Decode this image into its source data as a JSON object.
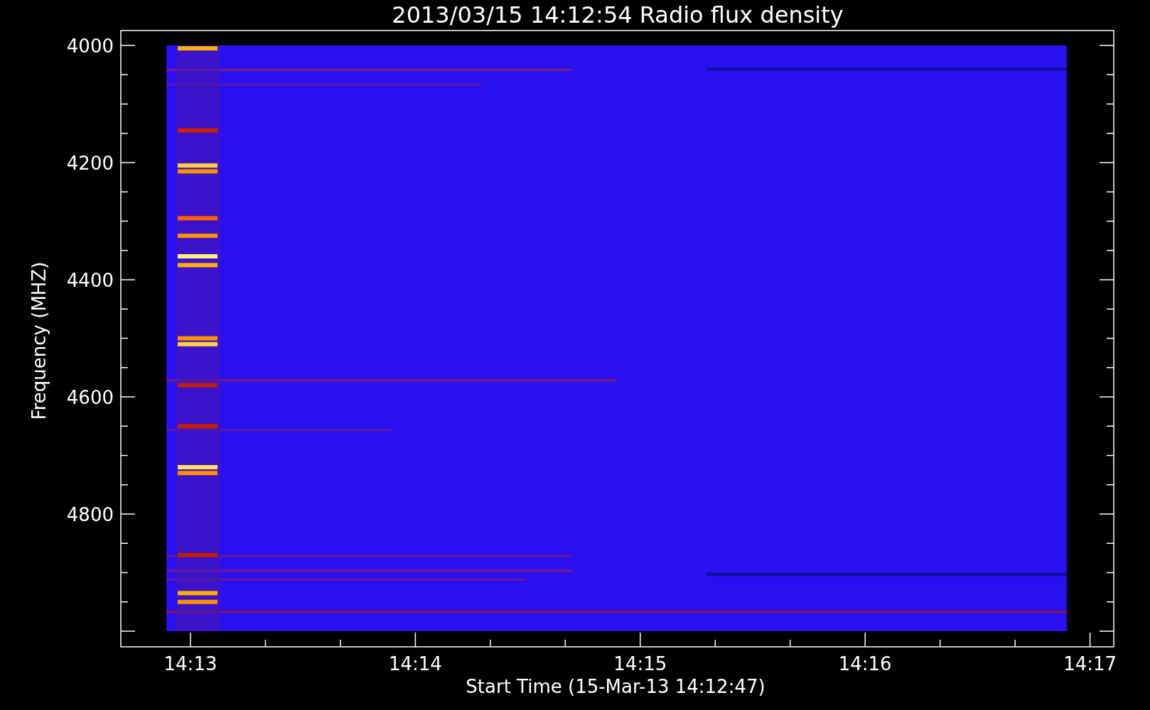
{
  "title": "2013/03/15 14:12:54 Radio flux density",
  "y_axis": {
    "label": "Frequency (MHZ)",
    "ticks": [
      "4000",
      "4200",
      "4400",
      "4600",
      "4800"
    ]
  },
  "x_axis": {
    "label": "Start Time (15-Mar-13 14:12:47)",
    "ticks": [
      "14:13",
      "14:14",
      "14:15",
      "14:16",
      "14:17"
    ]
  }
}
